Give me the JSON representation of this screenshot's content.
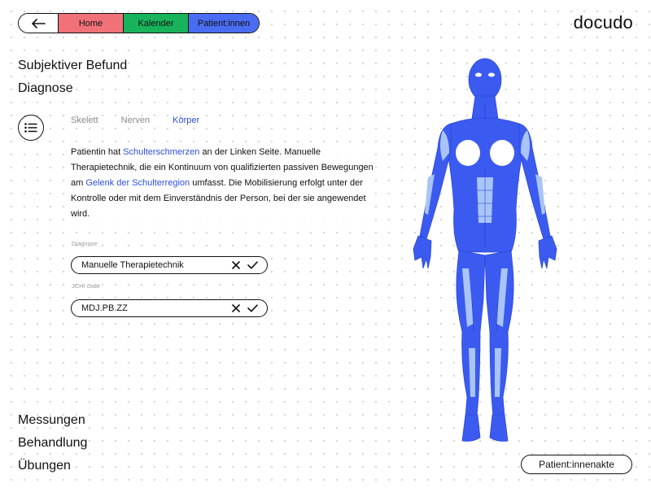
{
  "nav": {
    "back_icon": "arrow-left-icon",
    "home_label": "Home",
    "calendar_label": "Kalender",
    "patients_label": "Patient:innen",
    "home_color": "#f07178",
    "calendar_color": "#18b35a",
    "patients_color": "#4a6cf2"
  },
  "logo": "docudo",
  "sections": {
    "subjective": "Subjektiver Befund",
    "diagnosis": "Diagnose",
    "measurements": "Messungen",
    "treatment": "Behandlung",
    "exercises": "Übungen"
  },
  "menu_icon": "list-icon",
  "tabs": [
    {
      "label": "Skelett",
      "active": false
    },
    {
      "label": "Nerven",
      "active": false
    },
    {
      "label": "Körper",
      "active": true
    }
  ],
  "description": {
    "p1": "Patientin hat ",
    "link1": "Schulterschmerzen",
    "p2": " an der Linken Seite. Manuelle Therapietechnik, die ein Kontinuum von qualifizierten passiven Bewegungen am ",
    "link2": "Gelenk der Schulterregion",
    "p3": " umfasst. Die Mobilisierung erfolgt unter der Kontrolle oder mit dem Einverständnis der Person, bei der sie angewendet wird."
  },
  "fields": {
    "diagnosis_label": "Diagnose",
    "diagnosis_value": "Manuelle Therapietechnik",
    "jchi_label": "JCHI code",
    "jchi_value": "MDJ.PB.ZZ",
    "clear_icon": "close-icon",
    "confirm_icon": "check-icon"
  },
  "record_button": "Patient:innenakte",
  "accent_color": "#2f4fe0",
  "body_color": "#3b5bf0",
  "body_light_color": "#a9c4f7"
}
